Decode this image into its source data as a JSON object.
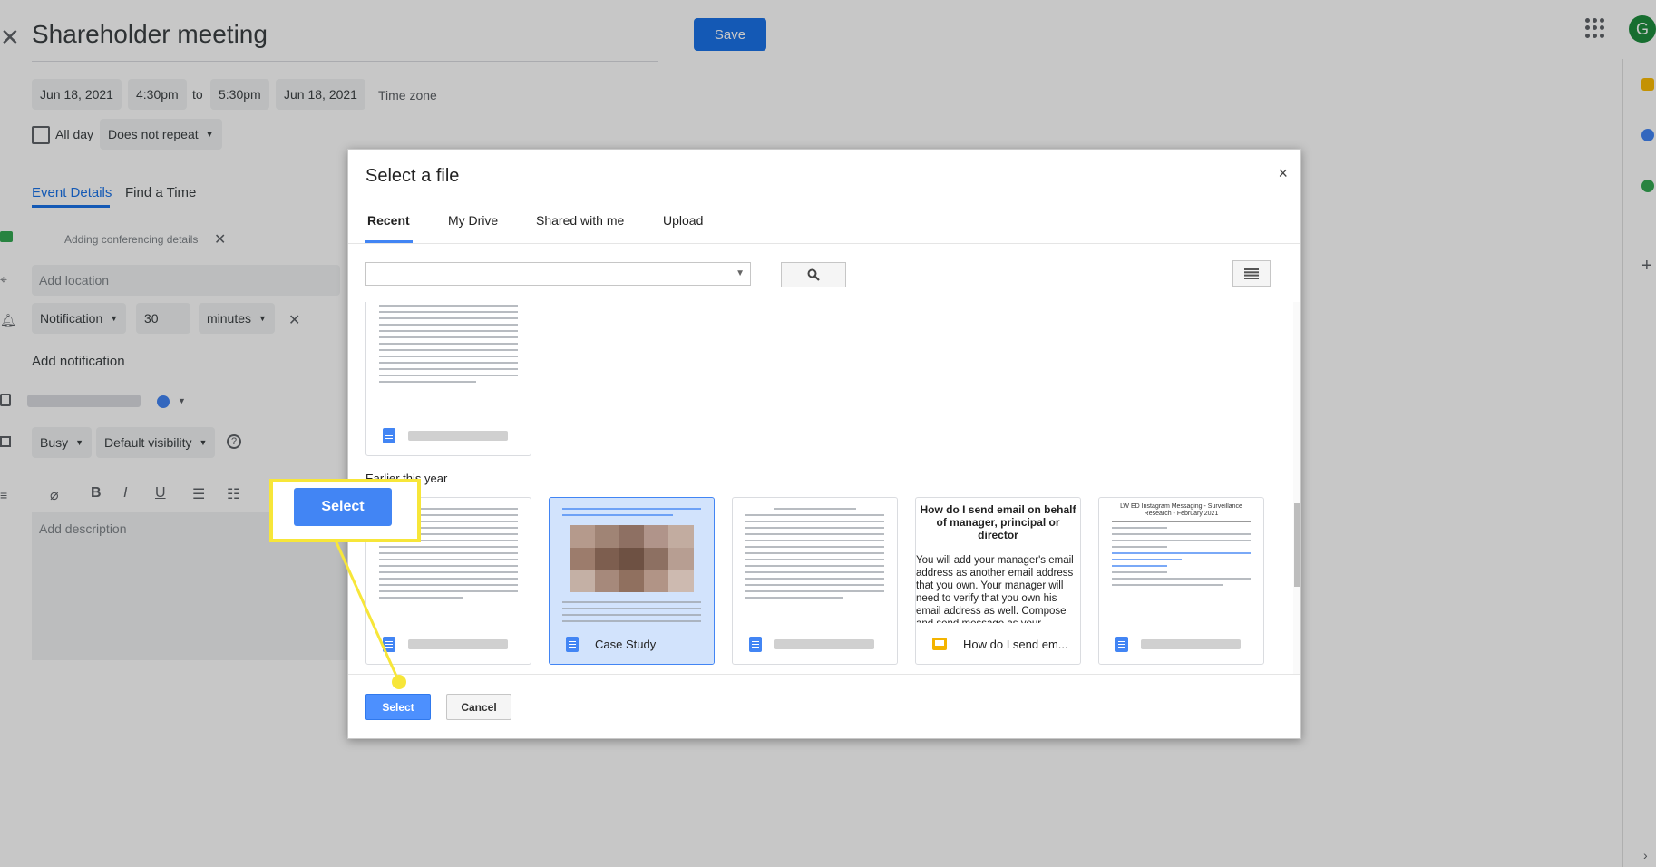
{
  "event": {
    "title": "Shareholder meeting",
    "save_label": "Save",
    "start_date": "Jun 18, 2021",
    "start_time": "4:30pm",
    "to_label": "to",
    "end_time": "5:30pm",
    "end_date": "Jun 18, 2021",
    "time_zone": "Time zone",
    "all_day": "All day",
    "repeat": "Does not repeat",
    "tabs": [
      "Event Details",
      "Find a Time"
    ],
    "conferencing": "Adding conferencing details",
    "location_placeholder": "Add location",
    "notification_type": "Notification",
    "notification_value": "30",
    "notification_unit": "minutes",
    "add_notification": "Add notification",
    "busy": "Busy",
    "visibility": "Default visibility",
    "description_placeholder": "Add description",
    "avatar_letter": "G"
  },
  "dialog": {
    "title": "Select a file",
    "close": "×",
    "tabs": [
      "Recent",
      "My Drive",
      "Shared with me",
      "Upload"
    ],
    "active_tab": "Recent",
    "section_label": "Earlier this year",
    "files": [
      {
        "name": "",
        "type": "doc"
      },
      {
        "name": "Case Study",
        "type": "doc",
        "selected": true
      },
      {
        "name": "",
        "type": "doc"
      },
      {
        "name": "How do I send em...",
        "type": "slides",
        "preview_heading": "How do I send email on behalf of manager, principal or director",
        "preview_body": "You will add your manager's email address as another email address that you own. Your manager will need to verify that you own his email address as well. Compose and send message as your manager."
      },
      {
        "name": "",
        "type": "doc",
        "preview_heading": "LW ED Instagram Messaging - Surveillance Research - February 2021"
      }
    ],
    "select_label": "Select",
    "cancel_label": "Cancel"
  },
  "callout": {
    "label": "Select",
    "color": "#f7e639"
  },
  "colors": {
    "accent": "#1a73e8",
    "dialog_button": "#4d90fe",
    "selected_card": "#d2e3fc"
  }
}
